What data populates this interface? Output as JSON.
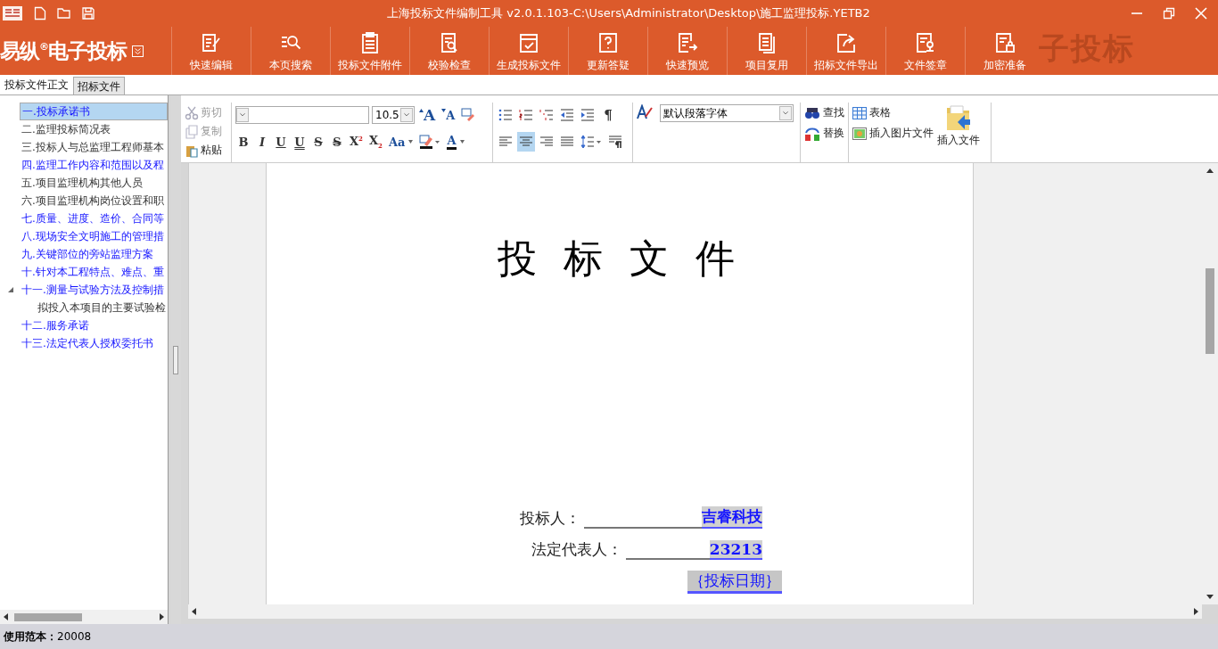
{
  "title_bar": {
    "title": "上海投标文件编制工具 v2.0.1.103-C:\\Users\\Administrator\\Desktop\\施工监理投标.YETB2"
  },
  "ribbon": {
    "logo": "易纵$^{®}$电子投标",
    "brand_mark": "子投标",
    "buttons": [
      {
        "label": "快速编辑",
        "kind": "edit"
      },
      {
        "label": "本页搜索",
        "kind": "search"
      },
      {
        "label": "投标文件附件",
        "kind": "clipboard"
      },
      {
        "label": "校验检查",
        "kind": "check"
      },
      {
        "label": "生成投标文件",
        "kind": "generate"
      },
      {
        "label": "更新答疑",
        "kind": "question"
      },
      {
        "label": "快速预览",
        "kind": "preview"
      },
      {
        "label": "项目复用",
        "kind": "copy"
      },
      {
        "label": "招标文件导出",
        "kind": "export"
      },
      {
        "label": "文件签章",
        "kind": "seal"
      },
      {
        "label": "加密准备",
        "kind": "lock"
      }
    ]
  },
  "tabs": [
    {
      "label": "投标文件正文",
      "selected": true
    },
    {
      "label": "招标文件",
      "selected": false
    }
  ],
  "tree": [
    {
      "label": "一.投标承诺书",
      "selected": true,
      "kind": "marked"
    },
    {
      "label": "二.监理投标简况表",
      "selected": false,
      "kind": "plain"
    },
    {
      "label": "三.投标人与总监理工程师基本",
      "selected": false,
      "kind": "plain"
    },
    {
      "label": "四.监理工作内容和范围以及程",
      "selected": false,
      "kind": "marked"
    },
    {
      "label": "五.项目监理机构其他人员",
      "selected": false,
      "kind": "plain"
    },
    {
      "label": "六.项目监理机构岗位设置和职",
      "selected": false,
      "kind": "plain"
    },
    {
      "label": "七.质量、进度、造价、合同等",
      "selected": false,
      "kind": "marked"
    },
    {
      "label": "八.现场安全文明施工的管理措",
      "selected": false,
      "kind": "marked"
    },
    {
      "label": "九.关键部位的旁站监理方案",
      "selected": false,
      "kind": "marked"
    },
    {
      "label": "十.针对本工程特点、难点、重",
      "selected": false,
      "kind": "marked"
    },
    {
      "label": "十一.测量与试验方法及控制措",
      "selected": false,
      "kind": "marked",
      "expanded": true,
      "children": [
        {
          "label": "拟投入本项目的主要试验检",
          "selected": false,
          "kind": "plain"
        }
      ]
    },
    {
      "label": "十二.服务承诺",
      "selected": false,
      "kind": "marked"
    },
    {
      "label": "十三.法定代表人授权委托书",
      "selected": false,
      "kind": "marked"
    }
  ],
  "toolbar": {
    "clipboard": [
      {
        "label": "剪切",
        "kind": "cut",
        "disabled": true
      },
      {
        "label": "复制",
        "kind": "copy",
        "disabled": true
      },
      {
        "label": "粘贴",
        "kind": "paste",
        "disabled": false
      }
    ],
    "font_size": "10.5",
    "font_buttons": [
      {
        "label": "A",
        "kind": "grow"
      },
      {
        "label": "A",
        "kind": "shrink"
      },
      {
        "kind": "clear"
      }
    ],
    "format_buttons": [
      {
        "label": "B",
        "kind": "bold"
      },
      {
        "label": "I",
        "kind": "italic"
      },
      {
        "label": "U",
        "kind": "underline"
      },
      {
        "label": "U",
        "kind": "double-underline"
      },
      {
        "label": "S",
        "kind": "strike"
      },
      {
        "label": "S",
        "kind": "double-strike"
      },
      {
        "label": "X$^{2}$",
        "kind": "superscript"
      },
      {
        "label": "X$_{2}$",
        "kind": "subscript"
      },
      {
        "label": "Aa",
        "kind": "case"
      },
      {
        "kind": "highlight"
      },
      {
        "label": "A",
        "kind": "font-color"
      }
    ],
    "list_buttons": [
      {
        "kind": "bullets"
      },
      {
        "kind": "numbering"
      },
      {
        "kind": "multilevel"
      },
      {
        "kind": "outdent"
      },
      {
        "kind": "indent"
      },
      {
        "label": "¶",
        "kind": "pilcrow"
      }
    ],
    "align_buttons": [
      {
        "kind": "left",
        "selected": false
      },
      {
        "kind": "center",
        "selected": true
      },
      {
        "kind": "right",
        "selected": false
      },
      {
        "kind": "justify",
        "selected": false
      }
    ],
    "style_select": "默认段落字体",
    "find": "查找",
    "replace": "替换",
    "table": "表格",
    "insert_picture": "插入图片文件",
    "insert_file": "插入文件"
  },
  "document": {
    "title": "投 标 文 件",
    "fields": [
      {
        "label": "投标人：",
        "value": "吉睿科技"
      },
      {
        "label": "法定代表人：",
        "value": "23213"
      }
    ],
    "date_field": "｛投标日期｝"
  },
  "status_bar": {
    "label": "使用范本：",
    "value": "20008"
  }
}
